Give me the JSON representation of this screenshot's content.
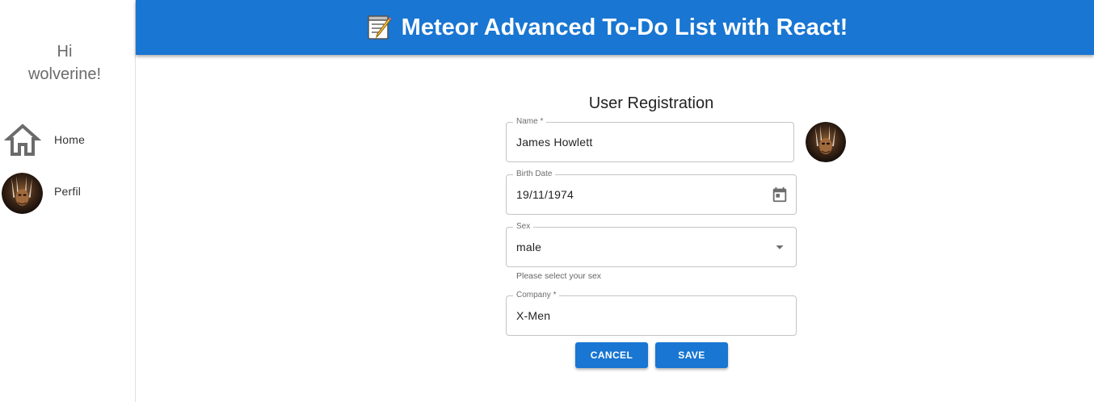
{
  "header": {
    "title": "Meteor Advanced To-Do List with React!",
    "icon": "memo-icon",
    "color": "#1976d2"
  },
  "sidebar": {
    "greeting_line1": "Hi",
    "greeting_line2": "wolverine!",
    "items": [
      {
        "label": "Home",
        "icon": "home-icon"
      },
      {
        "label": "Perfil",
        "icon": "avatar"
      }
    ]
  },
  "form": {
    "title": "User Registration",
    "fields": {
      "name": {
        "label": "Name *",
        "value": "James Howlett"
      },
      "birth_date": {
        "label": "Birth Date",
        "value": "19/11/1974",
        "icon": "calendar-icon"
      },
      "sex": {
        "label": "Sex",
        "value": "male",
        "helper": "Please select your sex",
        "icon": "dropdown-arrow-icon"
      },
      "company": {
        "label": "Company *",
        "value": "X-Men"
      }
    },
    "buttons": {
      "cancel": "CANCEL",
      "save": "SAVE"
    }
  }
}
